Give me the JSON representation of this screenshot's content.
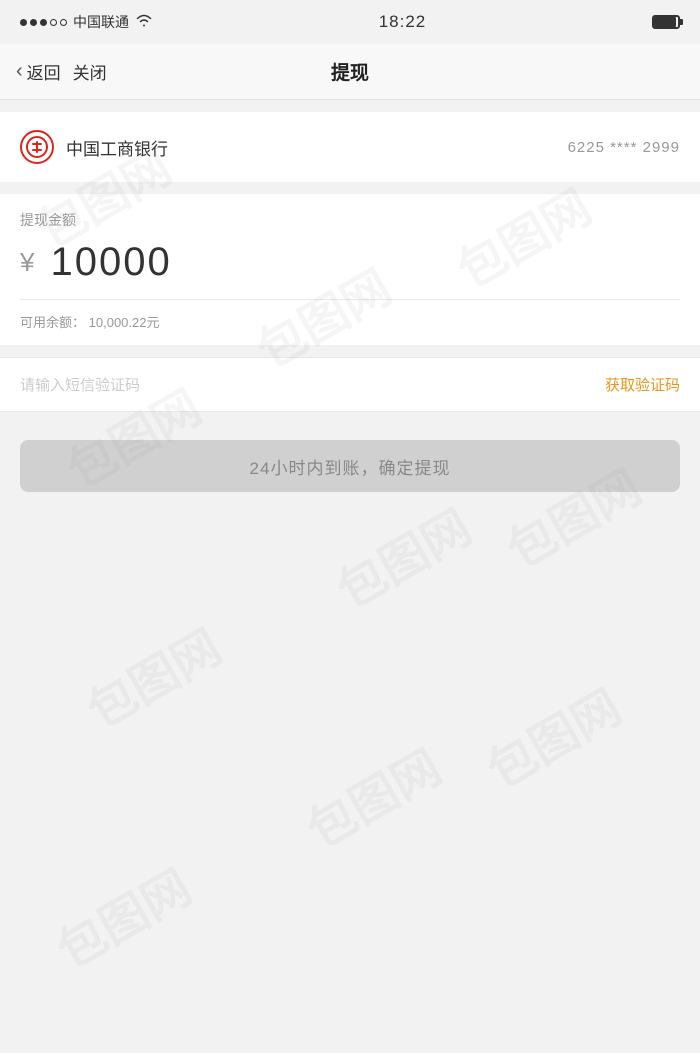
{
  "statusBar": {
    "carrier": "中国联通",
    "time": "18:22",
    "signal": [
      "filled",
      "filled",
      "filled",
      "empty",
      "empty"
    ]
  },
  "navBar": {
    "backLabel": "返回",
    "closeLabel": "关闭",
    "title": "提现"
  },
  "bankCard": {
    "bankName": "中国工商银行",
    "cardNumber": "6225 **** 2999"
  },
  "amountSection": {
    "label": "提现金额",
    "currencySymbol": "¥",
    "amount": "10000",
    "balanceLabel": "可用余额：",
    "balanceValue": "10,000.22元"
  },
  "verification": {
    "placeholder": "请输入短信验证码",
    "getCodeLabel": "获取验证码"
  },
  "confirmButton": {
    "label": "24小时内到账，确定提现"
  },
  "watermark": {
    "text": "包图网"
  }
}
